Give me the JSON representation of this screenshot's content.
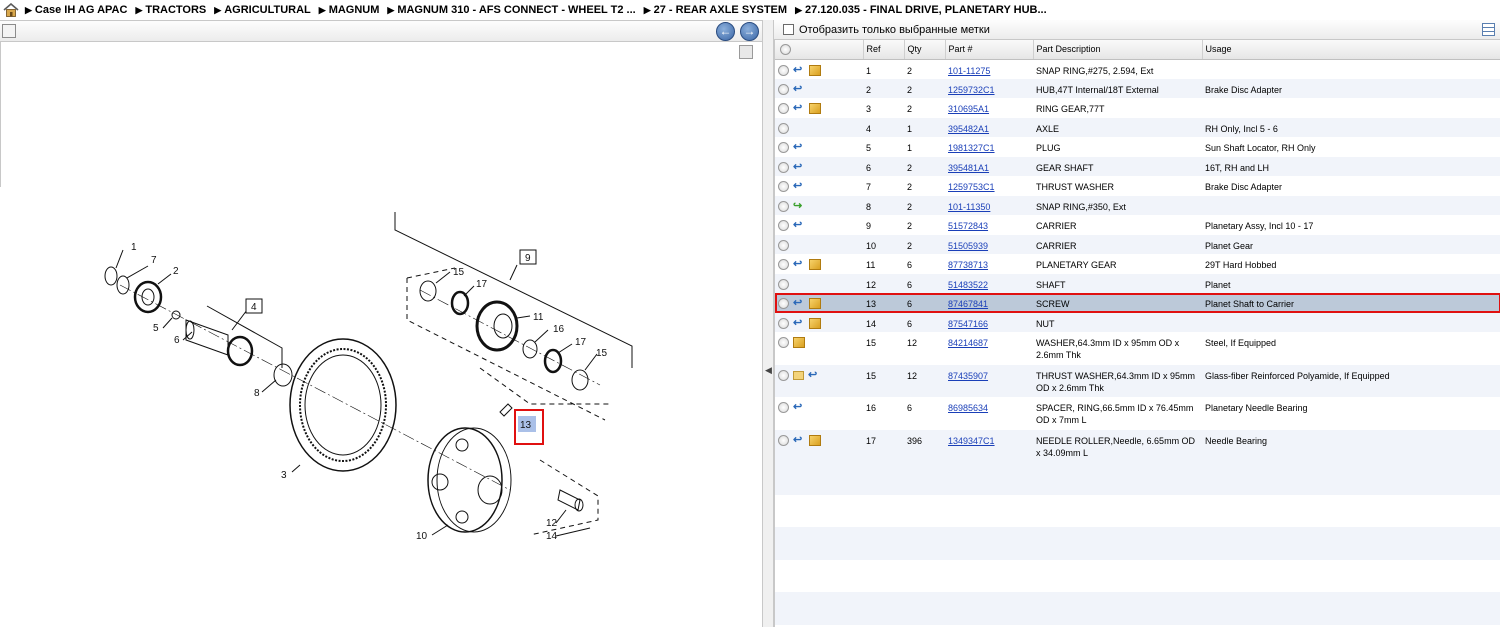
{
  "breadcrumb": [
    "Case IH AG APAC",
    "TRACTORS",
    "AGRICULTURAL",
    "MAGNUM",
    "MAGNUM 310 - AFS CONNECT - WHEEL T2 ...",
    "27 - REAR AXLE SYSTEM",
    "27.120.035 - FINAL DRIVE, PLANETARY HUB..."
  ],
  "filter": {
    "label": "Отобразить только выбранные метки"
  },
  "columns": {
    "ref": "Ref",
    "qty": "Qty",
    "part": "Part #",
    "desc": "Part Description",
    "usage": "Usage"
  },
  "rows": [
    {
      "icons": [
        "undo",
        "box"
      ],
      "ref": "1",
      "qty": "2",
      "part": "101-11275",
      "desc": "SNAP RING,#275, 2.594, Ext",
      "usage": ""
    },
    {
      "icons": [
        "undo"
      ],
      "ref": "2",
      "qty": "2",
      "part": "1259732C1",
      "desc": "HUB,47T Internal/18T External",
      "usage": "Brake Disc Adapter"
    },
    {
      "icons": [
        "undo",
        "box"
      ],
      "ref": "3",
      "qty": "2",
      "part": "310695A1",
      "desc": "RING GEAR,77T",
      "usage": ""
    },
    {
      "icons": [],
      "ref": "4",
      "qty": "1",
      "part": "395482A1",
      "desc": "AXLE",
      "usage": "RH Only, Incl 5 - 6"
    },
    {
      "icons": [
        "undo"
      ],
      "ref": "5",
      "qty": "1",
      "part": "1981327C1",
      "desc": "PLUG",
      "usage": "Sun Shaft Locator, RH Only"
    },
    {
      "icons": [
        "undo"
      ],
      "ref": "6",
      "qty": "2",
      "part": "395481A1",
      "desc": "GEAR SHAFT",
      "usage": "16T, RH and LH"
    },
    {
      "icons": [
        "undo"
      ],
      "ref": "7",
      "qty": "2",
      "part": "1259753C1",
      "desc": "THRUST WASHER",
      "usage": "Brake Disc Adapter"
    },
    {
      "icons": [
        "redo"
      ],
      "ref": "8",
      "qty": "2",
      "part": "101-11350",
      "desc": "SNAP RING,#350, Ext",
      "usage": ""
    },
    {
      "icons": [
        "undo"
      ],
      "ref": "9",
      "qty": "2",
      "part": "51572843",
      "desc": "CARRIER",
      "usage": "Planetary Assy, Incl 10 - 17"
    },
    {
      "icons": [],
      "ref": "10",
      "qty": "2",
      "part": "51505939",
      "desc": "CARRIER",
      "usage": "Planet Gear"
    },
    {
      "icons": [
        "undo",
        "box"
      ],
      "ref": "11",
      "qty": "6",
      "part": "87738713",
      "desc": "PLANETARY GEAR",
      "usage": "29T Hard Hobbed"
    },
    {
      "icons": [],
      "ref": "12",
      "qty": "6",
      "part": "51483522",
      "desc": "SHAFT",
      "usage": "Planet"
    },
    {
      "icons": [
        "undo",
        "box"
      ],
      "ref": "13",
      "qty": "6",
      "part": "87467841",
      "desc": "SCREW",
      "usage": "Planet Shaft to Carrier",
      "selected": true
    },
    {
      "icons": [
        "undo",
        "box"
      ],
      "ref": "14",
      "qty": "6",
      "part": "87547166",
      "desc": "NUT",
      "usage": ""
    },
    {
      "icons": [
        "box"
      ],
      "ref": "15",
      "qty": "12",
      "part": "84214687",
      "desc": "WASHER,64.3mm ID x 95mm OD x 2.6mm Thk",
      "usage": "Steel, If Equipped",
      "tall": true
    },
    {
      "icons": [
        "folder",
        "undo"
      ],
      "ref": "15",
      "qty": "12",
      "part": "87435907",
      "desc": "THRUST WASHER,64.3mm ID x 95mm OD x 2.6mm Thk",
      "usage": "Glass-fiber Reinforced Polyamide, If Equipped",
      "tall": true
    },
    {
      "icons": [
        "undo"
      ],
      "ref": "16",
      "qty": "6",
      "part": "86985634",
      "desc": "SPACER, RING,66.5mm ID x 76.45mm OD x 7mm L",
      "usage": "Planetary Needle Bearing",
      "tall": true
    },
    {
      "icons": [
        "undo",
        "box"
      ],
      "ref": "17",
      "qty": "396",
      "part": "1349347C1",
      "desc": "NEEDLE ROLLER,Needle, 6.65mm OD x 34.09mm L",
      "usage": "Needle Bearing",
      "tall": true
    }
  ],
  "diagram": {
    "labels": [
      "1",
      "7",
      "2",
      "5",
      "6",
      "4",
      "8",
      "3",
      "9",
      "15",
      "17",
      "11",
      "16",
      "17",
      "15",
      "13",
      "10",
      "12",
      "14"
    ],
    "highlight": "13"
  }
}
